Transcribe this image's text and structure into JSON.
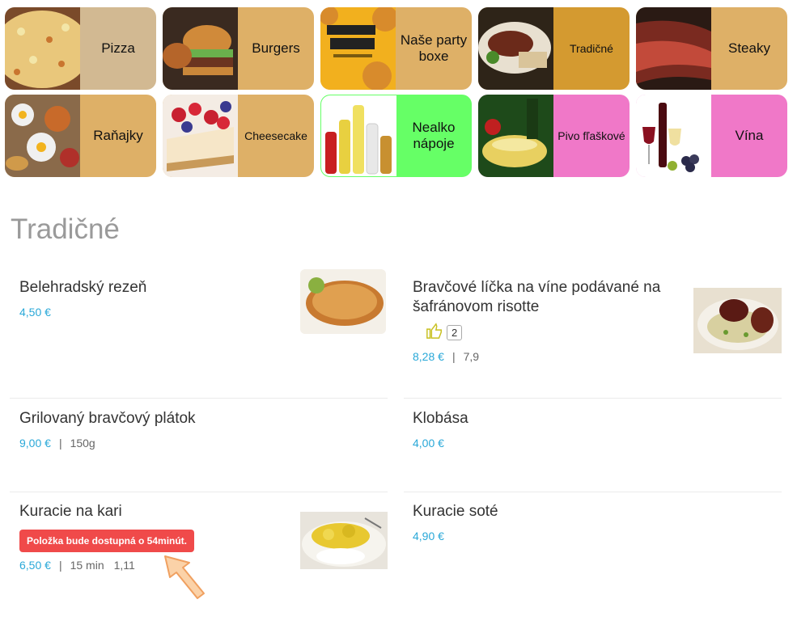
{
  "categories": [
    {
      "label": "Pizza",
      "color": "#d2b992"
    },
    {
      "label": "Burgers",
      "color": "#deb067"
    },
    {
      "label": "Naše party boxe",
      "color": "#deb067"
    },
    {
      "label": "Tradičné",
      "color": "#d49a30"
    },
    {
      "label": "Steaky",
      "color": "#deb067"
    },
    {
      "label": "Raňajky",
      "color": "#deb067"
    },
    {
      "label": "Cheesecake",
      "color": "#deb067"
    },
    {
      "label": "Nealko nápoje",
      "color": "#66ff66"
    },
    {
      "label": "Pivo fľaškové",
      "color": "#f078c8"
    },
    {
      "label": "Vína",
      "color": "#f078c8"
    }
  ],
  "section_title": "Tradičné",
  "items": [
    {
      "name": "Belehradský rezeň",
      "price": "4,50 €"
    },
    {
      "name": "Bravčové líčka na víne podávané na šafránovom risotte",
      "price": "8,28 €",
      "extra": "7,9",
      "likes": "2"
    },
    {
      "name": "Grilovaný bravčový plátok",
      "price": "9,00 €",
      "extra": "150g"
    },
    {
      "name": "Klobása",
      "price": "4,00 €"
    },
    {
      "name": "Kuracie na kari",
      "price": "6,50 €",
      "extra": "15 min",
      "extra2": "1,11",
      "badge": "Položka bude dostupná o 54minút."
    },
    {
      "name": "Kuracie soté",
      "price": "4,90 €"
    }
  ],
  "separator": "|"
}
